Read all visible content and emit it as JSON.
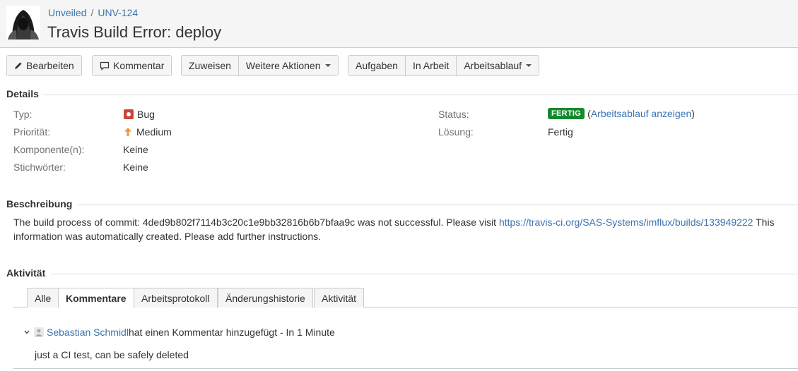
{
  "breadcrumb": {
    "project": "Unveiled",
    "separator": "/",
    "issue_key": "UNV-124"
  },
  "issue": {
    "title": "Travis Build Error: deploy"
  },
  "toolbar": {
    "edit_label": "Bearbeiten",
    "comment_label": "Kommentar",
    "assign_label": "Zuweisen",
    "more_actions_label": "Weitere Aktionen",
    "tasks_label": "Aufgaben",
    "in_progress_label": "In Arbeit",
    "workflow_label": "Arbeitsablauf"
  },
  "details": {
    "heading": "Details",
    "type_label": "Typ:",
    "type_value": "Bug",
    "priority_label": "Priorität:",
    "priority_value": "Medium",
    "components_label": "Komponente(n):",
    "components_value": "Keine",
    "labels_label": "Stichwörter:",
    "labels_value": "Keine",
    "status_label": "Status:",
    "status_value": "FERTIG",
    "status_link_open": "(",
    "status_link": "Arbeitsablauf anzeigen",
    "status_link_close": ")",
    "resolution_label": "Lösung:",
    "resolution_value": "Fertig"
  },
  "description": {
    "heading": "Beschreibung",
    "text_before": "The build process of commit: 4ded9b802f7114b3c20c1e9bb32816b6b7bfaa9c was not successful. Please visit ",
    "link": "https://travis-ci.org/SAS-Systems/imflux/builds/133949222",
    "text_after": " This information was automatically created. Please add further instructions."
  },
  "activity": {
    "heading": "Aktivität",
    "tabs": [
      "Alle",
      "Kommentare",
      "Arbeitsprotokoll",
      "Änderungshistorie",
      "Aktivität"
    ],
    "active_tab": "Kommentare"
  },
  "comment": {
    "author": "Sebastian Schmidl",
    "action": " hat einen Kommentar hinzugefügt - In 1 Minute",
    "body": "just a CI test, can be safely deleted"
  },
  "colors": {
    "link": "#3b73af",
    "status_done": "#14892c",
    "bug": "#d04437",
    "priority_medium": "#f79232"
  }
}
